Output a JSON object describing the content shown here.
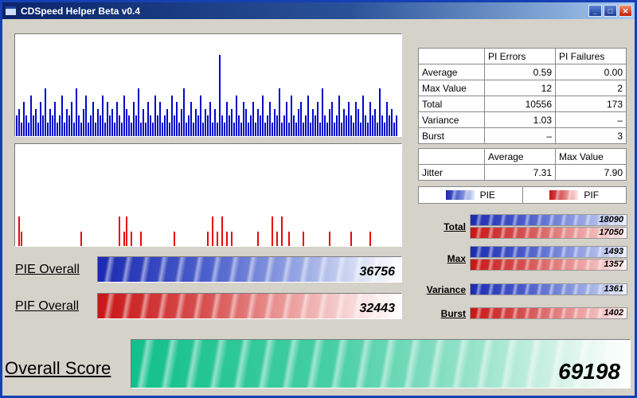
{
  "window": {
    "title": "CDSpeed Helper Beta v0.4",
    "controls": {
      "minimize_glyph": "_",
      "maximize_glyph": "□",
      "close_glyph": "✕"
    }
  },
  "tables": {
    "pi": {
      "headers": [
        "",
        "PI Errors",
        "PI Failures"
      ],
      "rows": [
        [
          "Average",
          "0.59",
          "0.00"
        ],
        [
          "Max Value",
          "12",
          "2"
        ],
        [
          "Total",
          "10556",
          "173"
        ],
        [
          "Variance",
          "1.03",
          "–"
        ],
        [
          "Burst",
          "–",
          "3"
        ]
      ]
    },
    "jitter": {
      "headers": [
        "",
        "Average",
        "Max Value"
      ],
      "rows": [
        [
          "Jitter",
          "7.31",
          "7.90"
        ]
      ]
    }
  },
  "legend": {
    "pie": "PIE",
    "pif": "PIF"
  },
  "side_bars": [
    {
      "label": "Total",
      "bars": [
        {
          "series": "PIE",
          "value": "18090"
        },
        {
          "series": "PIF",
          "value": "17050"
        }
      ]
    },
    {
      "label": "Max",
      "bars": [
        {
          "series": "PIE",
          "value": "1493"
        },
        {
          "series": "PIF",
          "value": "1357"
        }
      ]
    },
    {
      "label": "Variance",
      "bars": [
        {
          "series": "PIE",
          "value": "1361"
        }
      ]
    },
    {
      "label": "Burst",
      "bars": [
        {
          "series": "PIF",
          "value": "1402"
        }
      ]
    }
  ],
  "overall": {
    "pie_label": "PIE Overall",
    "pie_value": "36756",
    "pif_label": "PIF Overall",
    "pif_value": "32443",
    "score_label": "Overall Score",
    "score_value": "69198"
  },
  "colors": {
    "pie": "#0008c8",
    "pif": "#e80808",
    "score_green": "#12bf8b",
    "titlebar_left": "#0a246a",
    "titlebar_right": "#a6caf0",
    "frame": "#1540b4",
    "background": "#d5d2ca"
  },
  "chart_data": [
    {
      "type": "bar",
      "name": "PI Errors distribution",
      "color": "#0008c8",
      "ylim": [
        0,
        15
      ],
      "values": [
        3,
        4,
        2,
        5,
        3,
        2,
        6,
        3,
        4,
        2,
        5,
        3,
        7,
        2,
        4,
        3,
        5,
        2,
        3,
        6,
        2,
        4,
        3,
        5,
        2,
        7,
        3,
        2,
        4,
        6,
        2,
        3,
        5,
        2,
        4,
        3,
        6,
        2,
        5,
        3,
        4,
        2,
        5,
        3,
        2,
        6,
        4,
        3,
        2,
        5,
        3,
        7,
        2,
        4,
        2,
        5,
        3,
        2,
        6,
        3,
        5,
        2,
        3,
        4,
        2,
        6,
        3,
        5,
        2,
        4,
        7,
        2,
        3,
        5,
        2,
        4,
        3,
        6,
        2,
        4,
        3,
        5,
        2,
        4,
        2,
        12,
        3,
        2,
        5,
        3,
        4,
        2,
        6,
        3,
        2,
        5,
        4,
        2,
        3,
        5,
        2,
        4,
        3,
        6,
        2,
        3,
        5,
        2,
        4,
        3,
        7,
        2,
        3,
        5,
        2,
        6,
        3,
        2,
        4,
        5,
        2,
        3,
        6,
        2,
        4,
        3,
        5,
        2,
        7,
        3,
        2,
        4,
        5,
        2,
        3,
        6,
        2,
        4,
        3,
        5,
        3,
        2,
        5,
        4,
        2,
        6,
        3,
        2,
        5,
        3,
        4,
        2,
        7,
        3,
        2,
        5,
        3,
        4,
        2,
        3
      ]
    },
    {
      "type": "bar",
      "name": "PI Failures distribution",
      "color": "#e80808",
      "ylim": [
        0,
        7
      ],
      "values": [
        0,
        2,
        1,
        0,
        0,
        0,
        0,
        0,
        0,
        0,
        0,
        0,
        0,
        0,
        0,
        0,
        0,
        0,
        0,
        0,
        0,
        0,
        0,
        0,
        0,
        0,
        0,
        1,
        0,
        0,
        0,
        0,
        0,
        0,
        0,
        0,
        0,
        0,
        0,
        0,
        0,
        0,
        0,
        2,
        0,
        1,
        2,
        0,
        1,
        0,
        0,
        0,
        1,
        0,
        0,
        0,
        0,
        0,
        0,
        0,
        0,
        0,
        0,
        0,
        0,
        0,
        1,
        0,
        0,
        0,
        0,
        0,
        0,
        0,
        0,
        0,
        0,
        0,
        0,
        0,
        1,
        0,
        2,
        0,
        1,
        0,
        2,
        0,
        1,
        0,
        1,
        0,
        0,
        0,
        0,
        0,
        0,
        0,
        0,
        0,
        0,
        1,
        0,
        0,
        0,
        0,
        0,
        2,
        0,
        1,
        0,
        2,
        0,
        0,
        1,
        0,
        0,
        0,
        0,
        0,
        1,
        0,
        0,
        0,
        0,
        0,
        0,
        0,
        0,
        0,
        0,
        1,
        0,
        0,
        0,
        0,
        0,
        0,
        0,
        0,
        1,
        0,
        0,
        0,
        0,
        0,
        0,
        0,
        1,
        0,
        0,
        0,
        0,
        0,
        0,
        0,
        0,
        0,
        0,
        0
      ]
    }
  ]
}
